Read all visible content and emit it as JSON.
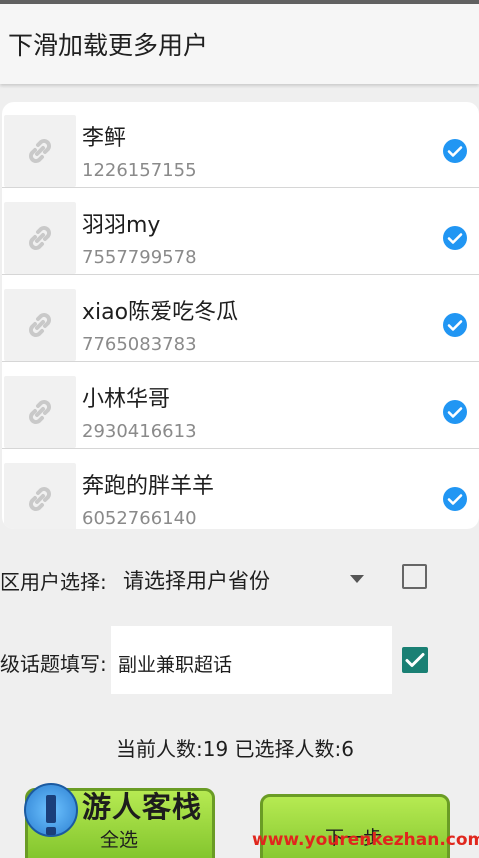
{
  "header": {
    "title": "下滑加载更多用户"
  },
  "users": [
    {
      "name": "李鲆",
      "id": "1226157155"
    },
    {
      "name": "羽羽my",
      "id": "7557799578"
    },
    {
      "name": "xiao陈爱吃冬瓜",
      "id": "7765083783"
    },
    {
      "name": "小林华哥",
      "id": "2930416613"
    },
    {
      "name": "奔跑的胖羊羊",
      "id": "6052766140"
    }
  ],
  "region": {
    "label": "地区用户选择:",
    "selected": "请选择用户省份",
    "enabled": false
  },
  "topic": {
    "label": "超级话题填写:",
    "value": "副业兼职超话",
    "enabled": true
  },
  "count_text": "当前人数:19 已选择人数:6",
  "buttons": {
    "select_all": "全选",
    "next": "下一步"
  },
  "watermark": {
    "name": "游人客栈",
    "url": "www.yourenkezhan.com"
  },
  "colors": {
    "check_blue": "#2196f3",
    "checkbox_teal": "#1a8074",
    "button_green": "#8fd33a",
    "watermark_red": "#e0261d"
  }
}
